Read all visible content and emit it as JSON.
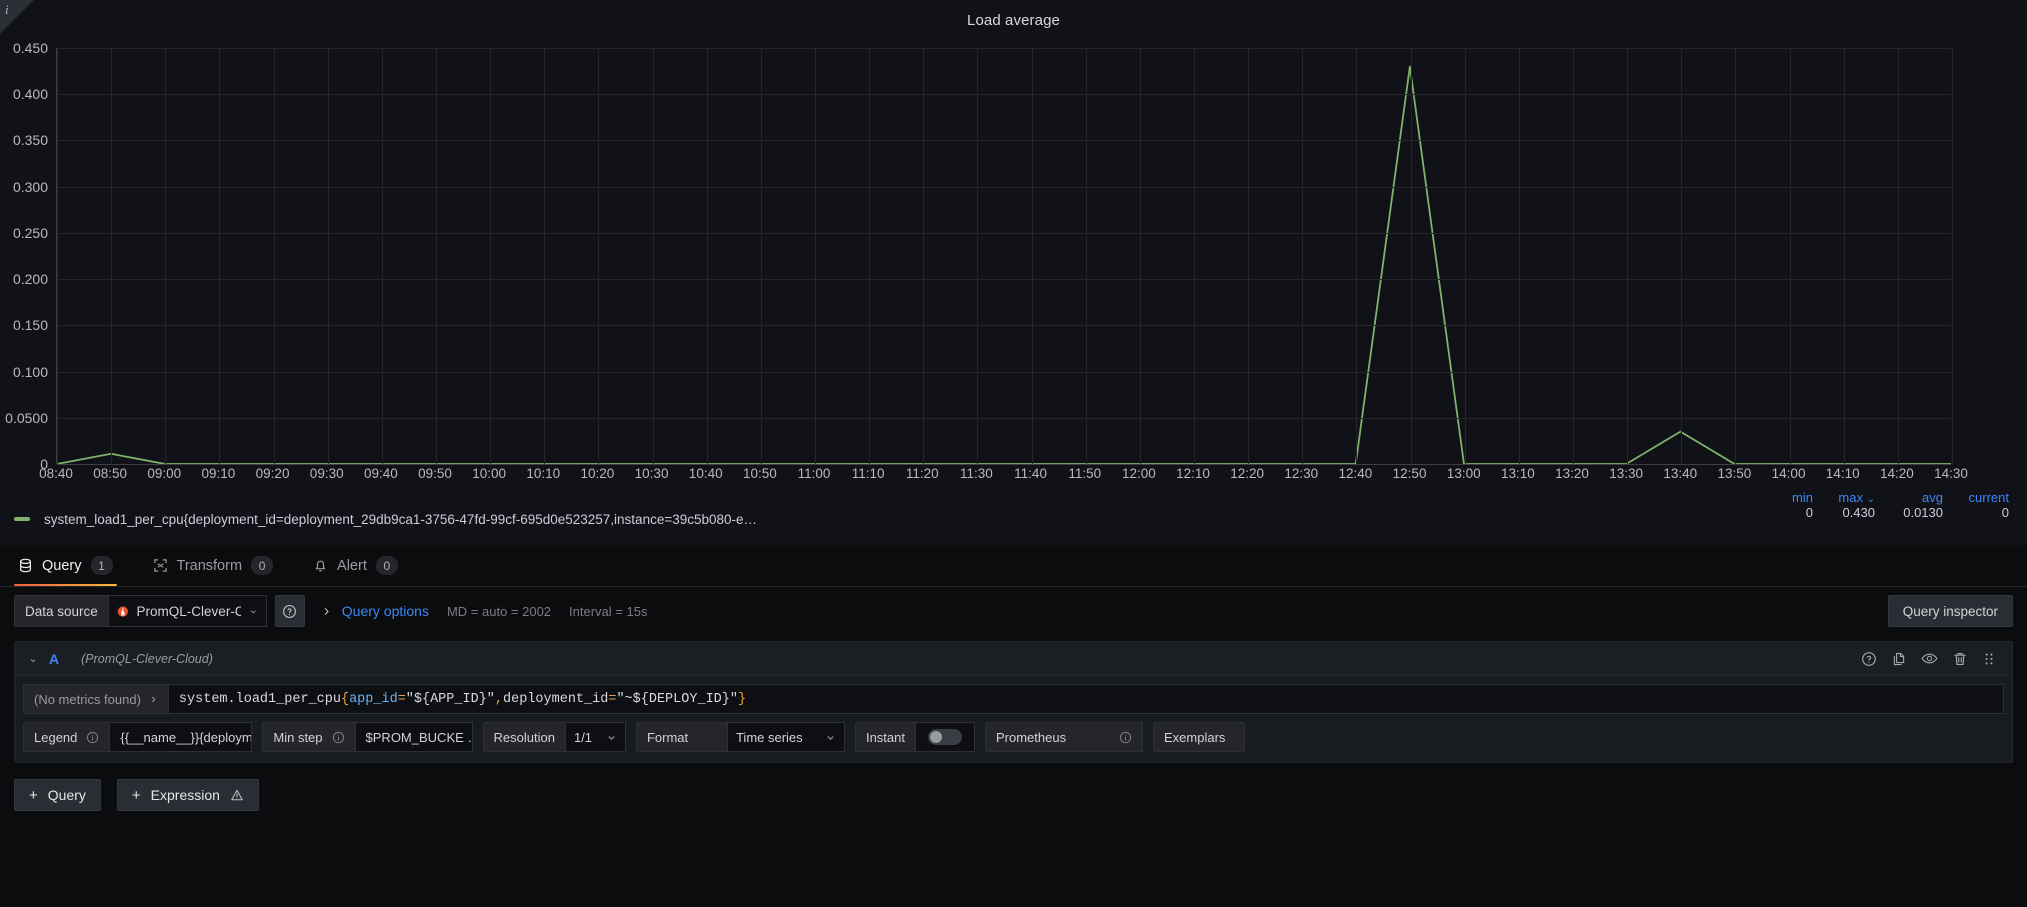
{
  "panel": {
    "title": "Load average",
    "info_corner_icon": "info-italic-icon"
  },
  "chart_data": {
    "type": "line",
    "title": "Load average",
    "xlabel": "",
    "ylabel": "",
    "grid": true,
    "legend_position": "bottom",
    "ylim": [
      0,
      0.45
    ],
    "ytick_labels": [
      "0.450",
      "0.400",
      "0.350",
      "0.300",
      "0.250",
      "0.200",
      "0.150",
      "0.100",
      "0.0500",
      "0"
    ],
    "ytick_values": [
      0.45,
      0.4,
      0.35,
      0.3,
      0.25,
      0.2,
      0.15,
      0.1,
      0.05,
      0
    ],
    "xtick_labels": [
      "08:40",
      "08:50",
      "09:00",
      "09:10",
      "09:20",
      "09:30",
      "09:40",
      "09:50",
      "10:00",
      "10:10",
      "10:20",
      "10:30",
      "10:40",
      "10:50",
      "11:00",
      "11:10",
      "11:20",
      "11:30",
      "11:40",
      "11:50",
      "12:00",
      "12:10",
      "12:20",
      "12:30",
      "12:40",
      "12:50",
      "13:00",
      "13:10",
      "13:20",
      "13:30",
      "13:40",
      "13:50",
      "14:00",
      "14:10",
      "14:20",
      "14:30"
    ],
    "series": [
      {
        "name": "system_load1_per_cpu{deployment_id=deployment_29db9ca1-3756-47fd-99cf-695d0e523257,instance=39c5b080-e…",
        "color": "#7EB26D",
        "x": [
          "08:40",
          "08:50",
          "09:00",
          "09:10",
          "09:20",
          "09:30",
          "09:40",
          "09:50",
          "10:00",
          "10:10",
          "10:20",
          "10:30",
          "10:40",
          "10:50",
          "11:00",
          "11:10",
          "11:20",
          "11:30",
          "11:40",
          "11:50",
          "12:00",
          "12:10",
          "12:20",
          "12:30",
          "12:40",
          "12:50",
          "13:00",
          "13:10",
          "13:20",
          "13:30",
          "13:40",
          "13:50",
          "14:00",
          "14:10",
          "14:20",
          "14:30"
        ],
        "values": [
          0,
          0.011,
          0,
          0,
          0,
          0,
          0,
          0,
          0,
          0,
          0,
          0,
          0,
          0,
          0,
          0,
          0,
          0,
          0,
          0,
          0,
          0,
          0,
          0,
          0,
          0.43,
          0,
          0,
          0,
          0,
          0.035,
          0,
          0,
          0,
          0,
          0
        ]
      }
    ],
    "stats_headers": [
      "min",
      "max",
      "avg",
      "current"
    ],
    "stats_values": [
      "0",
      "0.430",
      "0.0130",
      "0"
    ],
    "sorted_by": "max"
  },
  "legend": {
    "series_label": "system_load1_per_cpu{deployment_id=deployment_29db9ca1-3756-47fd-99cf-695d0e523257,instance=39c5b080-e…",
    "swatch_color": "#7EB26D",
    "headers": {
      "min": "min",
      "max": "max",
      "avg": "avg",
      "current": "current"
    },
    "values": {
      "min": "0",
      "max": "0.430",
      "avg": "0.0130",
      "current": "0"
    }
  },
  "tabs": [
    {
      "label": "Query",
      "badge": "1",
      "active": true,
      "icon": "database-icon"
    },
    {
      "label": "Transform",
      "badge": "0",
      "active": false,
      "icon": "transform-icon"
    },
    {
      "label": "Alert",
      "badge": "0",
      "active": false,
      "icon": "bell-icon"
    }
  ],
  "datasource_row": {
    "label": "Data source",
    "selected": "PromQL-Clever-Cloud",
    "help_icon": "question-circle-icon",
    "chevron_icon": "chevron-down-icon",
    "prometheus_icon": "prometheus-flame-icon",
    "query_options_label": "Query options",
    "query_options_expand_icon": "chevron-right-icon",
    "max_data_points": "MD = auto = 2002",
    "interval": "Interval = 15s",
    "query_inspector_label": "Query inspector"
  },
  "query_row": {
    "ref_id": "A",
    "datasource_name": "(PromQL-Clever-Cloud)",
    "collapse_icon": "chevron-down-icon",
    "actions": [
      "help-circle-icon",
      "duplicate-icon",
      "eye-icon",
      "trash-icon",
      "drag-handle-icon"
    ],
    "metric_select_label": "(No metrics found)",
    "metric_select_chevron": "chevron-right-icon",
    "expression": {
      "full": "system.load1_per_cpu{app_id=\"${APP_ID}\",deployment_id=\"~${DEPLOY_ID}\"}",
      "tokens": [
        {
          "t": "system.load1_per_cpu",
          "c": "fn"
        },
        {
          "t": "{",
          "c": "brace"
        },
        {
          "t": "app_id",
          "c": "key"
        },
        {
          "t": "=",
          "c": "op"
        },
        {
          "t": "\"${APP_ID}\"",
          "c": "str"
        },
        {
          "t": ",",
          "c": "op"
        },
        {
          "t": "deployment_id",
          "c": "str"
        },
        {
          "t": "=",
          "c": "op"
        },
        {
          "t": "\"~${DEPLOY_ID}\"",
          "c": "str"
        },
        {
          "t": "}",
          "c": "brace"
        }
      ]
    },
    "options": {
      "legend_label": "Legend",
      "legend_value": "{{__name__}}{deployment …",
      "legend_info_icon": "info-circle-icon",
      "min_step_label": "Min step",
      "min_step_value": "$PROM_BUCKE …",
      "min_step_info_icon": "info-circle-icon",
      "resolution_label": "Resolution",
      "resolution_value": "1/1",
      "format_label": "Format",
      "format_value": "Time series",
      "instant_label": "Instant",
      "instant_on": false,
      "prometheus_label": "Prometheus",
      "prometheus_info_icon": "info-circle-icon",
      "exemplars_label": "Exemplars",
      "exemplars_icon": "target-icon"
    }
  },
  "footer": {
    "add_query_label": "Query",
    "add_expression_label": "Expression",
    "add_icon": "plus-icon",
    "expression_warn_icon": "warning-triangle-icon"
  }
}
